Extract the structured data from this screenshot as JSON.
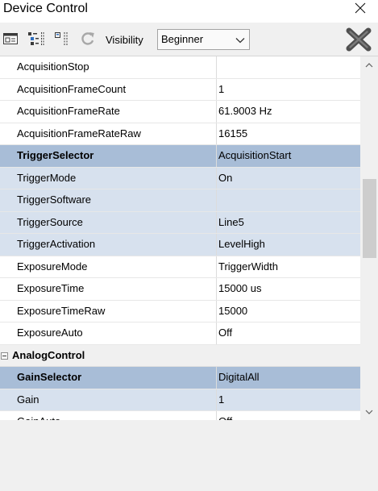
{
  "window": {
    "title": "Device Control",
    "close_icon": "close-icon"
  },
  "toolbar": {
    "buttons": [
      {
        "icon": "window-icon"
      },
      {
        "icon": "tree-view-icon"
      },
      {
        "icon": "list-view-icon"
      },
      {
        "icon": "refresh-icon",
        "enabled": false
      }
    ],
    "visibility_label": "Visibility",
    "visibility_value": "Beginner",
    "right_button_icon": "x-icon"
  },
  "property_grid": {
    "rows": [
      {
        "name": "AcquisitionStop",
        "value": ""
      },
      {
        "name": "AcquisitionFrameCount",
        "value": "1"
      },
      {
        "name": "AcquisitionFrameRate",
        "value": "61.9003 Hz"
      },
      {
        "name": "AcquisitionFrameRateRaw",
        "value": "16155"
      },
      {
        "name": "TriggerSelector",
        "value": "AcquisitionStart",
        "selector": true
      },
      {
        "name": "TriggerMode",
        "value": "On",
        "linked": true
      },
      {
        "name": "TriggerSoftware",
        "value": "",
        "linked": true
      },
      {
        "name": "TriggerSource",
        "value": "Line5",
        "linked": true
      },
      {
        "name": "TriggerActivation",
        "value": "LevelHigh",
        "linked": true
      },
      {
        "name": "ExposureMode",
        "value": "TriggerWidth"
      },
      {
        "name": "ExposureTime",
        "value": "15000 us"
      },
      {
        "name": "ExposureTimeRaw",
        "value": "15000"
      },
      {
        "name": "ExposureAuto",
        "value": "Off"
      },
      {
        "category": "AnalogControl",
        "expanded": true
      },
      {
        "name": "GainSelector",
        "value": "DigitalAll",
        "selector": true
      },
      {
        "name": "Gain",
        "value": "1",
        "linked": true
      },
      {
        "name": "GainAuto",
        "value": "Off"
      }
    ]
  },
  "scrollbar": {
    "up_icon": "chevron-up-icon",
    "down_icon": "chevron-down-icon"
  },
  "colors": {
    "selector_row": "#a8bdd7",
    "linked_row": "#d7e1ee",
    "category_row": "#f0f0f0",
    "toolbar_bg": "#f0f0f0"
  }
}
